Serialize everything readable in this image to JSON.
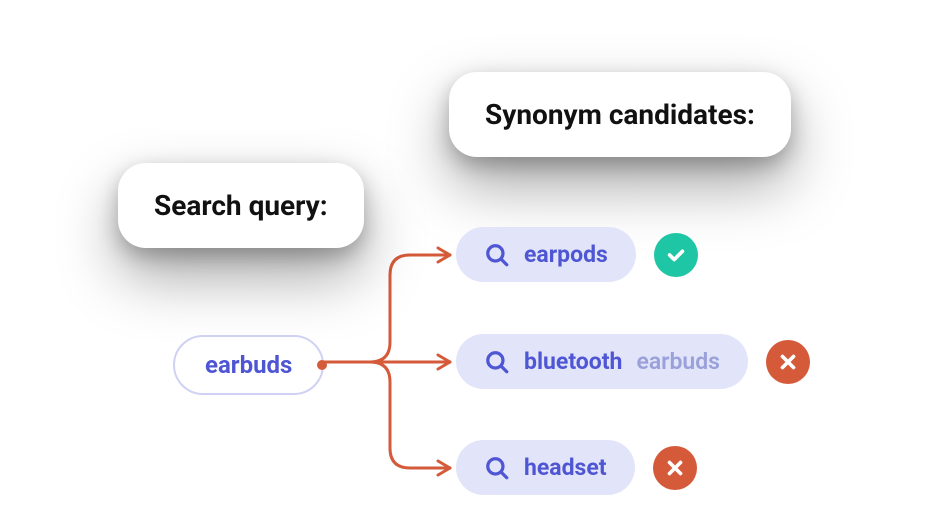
{
  "query_section": {
    "heading": "Search query:",
    "term": "earbuds"
  },
  "candidates_section": {
    "heading": "Synonym candidates:"
  },
  "candidates": [
    {
      "term_primary": "earpods",
      "term_secondary": "",
      "status": "accept"
    },
    {
      "term_primary": "bluetooth",
      "term_secondary": "earbuds",
      "status": "reject"
    },
    {
      "term_primary": "headset",
      "term_secondary": "",
      "status": "reject"
    }
  ],
  "colors": {
    "connector": "#d55a3a",
    "accept": "#1fc6a6",
    "reject": "#d55a3a",
    "pill_bg": "#e2e4fa",
    "pill_text": "#4f56d3"
  }
}
